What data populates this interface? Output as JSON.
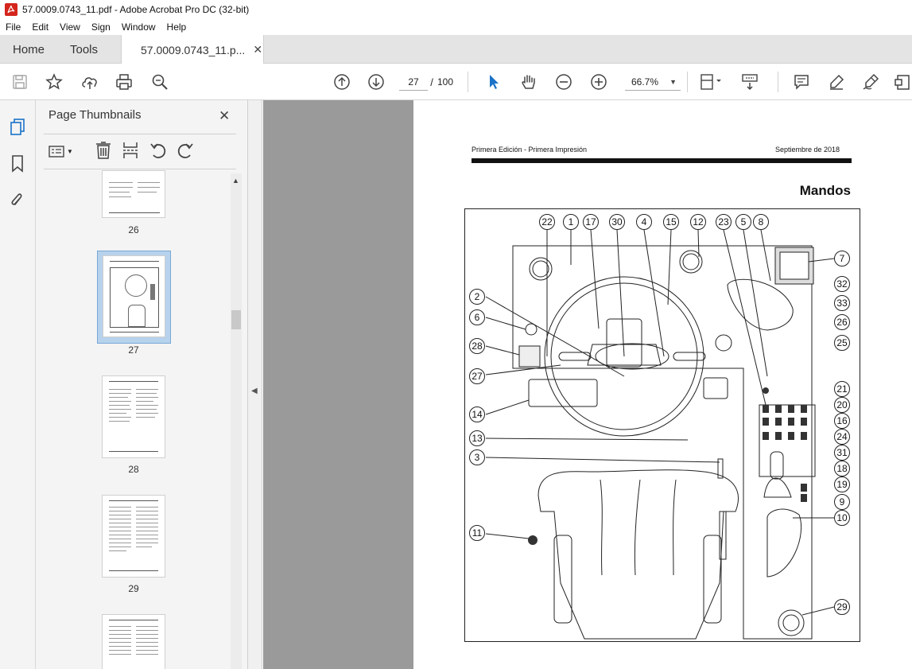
{
  "window": {
    "title": "57.0009.0743_11.pdf - Adobe Acrobat Pro DC (32-bit)"
  },
  "menu": [
    "File",
    "Edit",
    "View",
    "Sign",
    "Window",
    "Help"
  ],
  "tabs": {
    "home": "Home",
    "tools": "Tools",
    "doc": "57.0009.0743_11.p..."
  },
  "toolbar": {
    "current_page": "27",
    "page_sep": "/",
    "total_pages": "100",
    "zoom": "66.7%"
  },
  "panel": {
    "title": "Page Thumbnails",
    "thumbs": [
      {
        "label": "26"
      },
      {
        "label": "27",
        "selected": true
      },
      {
        "label": "28"
      },
      {
        "label": "29"
      },
      {
        "label": ""
      }
    ]
  },
  "document": {
    "header_left": "Primera Edición - Primera Impresión",
    "header_right": "Septiembre de 2018",
    "heading": "Mandos",
    "callouts": [
      "22",
      "1",
      "17",
      "30",
      "4",
      "15",
      "12",
      "23",
      "5",
      "8",
      "7",
      "32",
      "33",
      "26",
      "25",
      "2",
      "6",
      "28",
      "27",
      "14",
      "13",
      "3",
      "11",
      "21",
      "20",
      "16",
      "24",
      "31",
      "18",
      "19",
      "9",
      "10",
      "29"
    ]
  },
  "colors": {
    "accent": "#1a73c8",
    "tabbar": "#e4e4e4",
    "doc_bg": "#9a9a9a"
  }
}
